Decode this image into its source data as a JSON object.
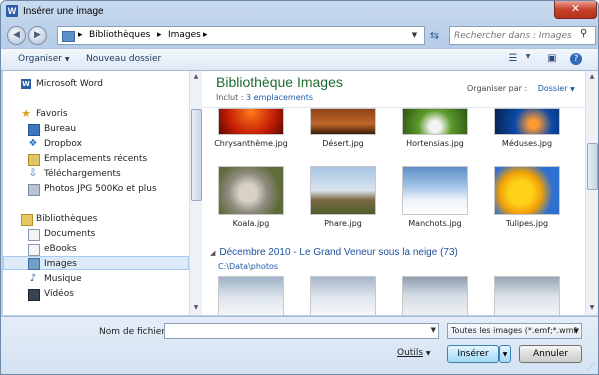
{
  "window": {
    "title": "Insérer une image",
    "app_icon": "W",
    "close_glyph": "✕"
  },
  "address": {
    "segments": [
      "Bibliothèques",
      "Images"
    ],
    "search_placeholder": "Rechercher dans : Images"
  },
  "toolbar": {
    "organize": "Organiser",
    "organize_arrow": "▼",
    "new_folder": "Nouveau dossier"
  },
  "nav": {
    "word": "Microsoft Word",
    "favorites": "Favoris",
    "fav_items": [
      "Bureau",
      "Dropbox",
      "Emplacements récents",
      "Téléchargements",
      "Photos JPG 500Ko et plus"
    ],
    "libraries": "Bibliothèques",
    "lib_items": [
      "Documents",
      "eBooks",
      "Images",
      "Musique",
      "Vidéos"
    ]
  },
  "content": {
    "library_title": "Bibliothèque Images",
    "include_label": "Inclut :",
    "include_link": "3 emplacements",
    "arrange_label": "Organiser par :",
    "arrange_value": "Dossier",
    "top_row": [
      "Chrysanthème.jpg",
      "Désert.jpg",
      "Hortensias.jpg",
      "Méduses.jpg"
    ],
    "middle_row": [
      "Koala.jpg",
      "Phare.jpg",
      "Manchots.jpg",
      "Tulipes.jpg"
    ],
    "group_title": "Décembre 2010 - Le Grand Veneur sous la neige (73)",
    "group_path": "C:\\Data\\photos"
  },
  "bottom": {
    "filename_label": "Nom de fichier :",
    "filename_value": "",
    "filter": "Toutes les images (*.emf;*.wmf",
    "tools": "Outils",
    "insert": "Insérer",
    "cancel": "Annuler"
  },
  "colors": {
    "library_title": "#1e6b30",
    "link": "#1a5aa8",
    "selection": "#dceaf9"
  }
}
